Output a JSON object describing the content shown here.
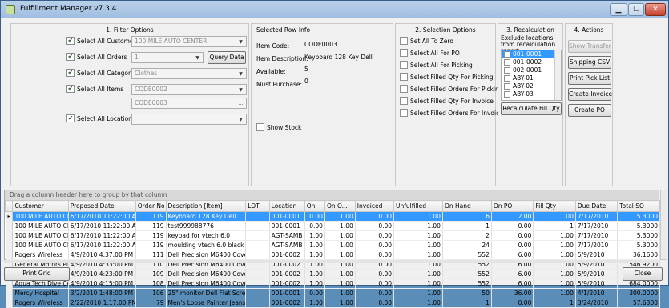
{
  "window": {
    "title": "Fulfillment Manager v7.3.4"
  },
  "filter": {
    "title": "1. Filter Options",
    "customers": {
      "label": "Select All Customers",
      "value": "100 MILE AUTO CENTER"
    },
    "orders": {
      "label": "Select All Orders",
      "value": "1",
      "button": "Query Data"
    },
    "categories": {
      "label": "Select All Categories",
      "value": "Clothes"
    },
    "items": {
      "label": "Select All Items",
      "value1": "CODE0002",
      "value2": "CODE0003"
    },
    "locations": {
      "label": "Select All Locations",
      "value": ""
    }
  },
  "row_info": {
    "title": "Selected Row Info",
    "item_code_label": "Item Code:",
    "item_code": "CODE0003",
    "desc_label": "Item Description:",
    "desc": "Keyboard 128 Key Dell",
    "available_label": "Available:",
    "available": "5",
    "must_purchase_label": "Must Purchase:",
    "must_purchase": "0",
    "show_stock": "Show Stock"
  },
  "selection": {
    "title": "2. Selection Options",
    "options": [
      "Set All To Zero",
      "Select All For PO",
      "Select All For Picking",
      "Select Filled Qty For Picking",
      "Select Filled Orders For Picking",
      "Select Filled Qty For Invoice",
      "Select Filled Orders For Invoice"
    ]
  },
  "recalc": {
    "title": "3. Recalculation",
    "note": "Exclude locations from recalculation report",
    "locations": [
      "001-0001",
      "001-0002",
      "002-0001",
      "ABY-01",
      "ABY-02",
      "ABY-03"
    ],
    "button": "Recalculate Fill Qty"
  },
  "actions": {
    "title": "4. Actions",
    "buttons": [
      "Show Transfer",
      "Shipping CSV",
      "Print Pick List",
      "Create Invoice",
      "Create PO"
    ]
  },
  "grid": {
    "group_hint": "Drag a column header here to group by that column",
    "columns": [
      "Customer",
      "Proposed Date",
      "Order No",
      "Description [Item]",
      "LOT",
      "Location",
      "On",
      "On O...",
      "Invoiced",
      "Unfulfilled",
      "On Hand",
      "On PO",
      "Fill Qty",
      "Due Date",
      "Total SO"
    ],
    "rows": [
      [
        "100 MILE AUTO CENTER",
        "6/17/2010 11:22:00 AM",
        "119",
        "Keyboard 128 Key Dell",
        "",
        "001-0001",
        "0.00",
        "1.00",
        "0.00",
        "1.00",
        "6",
        "2.00",
        "1.00",
        "7/17/2010",
        "5.3000"
      ],
      [
        "100 MILE AUTO CENTER",
        "6/17/2010 11:22:00 AM",
        "119",
        "test999988776",
        "",
        "001-0001",
        "0.00",
        "1.00",
        "0.00",
        "1.00",
        "1",
        "0.00",
        "1",
        "7/17/2010",
        "5.3000"
      ],
      [
        "100 MILE AUTO CENTER",
        "6/17/2010 11:22:00 AM",
        "119",
        "keypad for vtech 6.0",
        "",
        "AGT-SAMB",
        "1.00",
        "1.00",
        "0.00",
        "1.00",
        "2",
        "0.00",
        "1.00",
        "7/17/2010",
        "5.3000"
      ],
      [
        "100 MILE AUTO CENTER",
        "6/17/2010 11:22:00 AM",
        "119",
        "moulding vtech 6.0 black",
        "",
        "AGT-SAMB",
        "1.00",
        "1.00",
        "0.00",
        "1.00",
        "24",
        "0.00",
        "1.00",
        "7/17/2010",
        "5.3000"
      ],
      [
        "Rogers Wireless",
        "4/9/2010 4:37:00 PM",
        "111",
        "Dell Precision M6400 Covet",
        "",
        "001-0002",
        "1.00",
        "1.00",
        "0.00",
        "1.00",
        "552",
        "6.00",
        "1.00",
        "5/9/2010",
        "36.1600"
      ],
      [
        "General Motors Place",
        "4/9/2010 4:33:00 PM",
        "110",
        "Dell Precision M6400 Covet",
        "",
        "001-0002",
        "1.00",
        "1.00",
        "0.00",
        "1.00",
        "552",
        "6.00",
        "1.00",
        "5/9/2010",
        "546.9200"
      ],
      [
        "Aqua Tech Dive Center",
        "4/9/2010 4:23:00 PM",
        "109",
        "Dell Precision M6400 Covet",
        "",
        "001-0002",
        "1.00",
        "1.00",
        "0.00",
        "1.00",
        "552",
        "6.00",
        "1.00",
        "5/9/2010",
        "1384.0000"
      ],
      [
        "Aqua Tech Dive Center",
        "4/9/2010 4:15:00 PM",
        "108",
        "Dell Precision M6400 Covet",
        "",
        "001-0002",
        "1.00",
        "1.00",
        "0.00",
        "1.00",
        "552",
        "6.00",
        "1.00",
        "5/9/2010",
        "684.0000"
      ],
      [
        "Mercy Hospital",
        "3/2/2010 1:48:00 PM",
        "106",
        "25\" monitor Dell Flat Screen",
        "",
        "001-0001",
        "0.00",
        "1.00",
        "0.00",
        "1.00",
        "50",
        "36.00",
        "1.00",
        "4/1/2010",
        "300.0000"
      ],
      [
        "Rogers Wireless",
        "2/22/2010 1:17:00 PM",
        "79",
        "Men's Loose Painter Jeans",
        "",
        "001-0002",
        "1.00",
        "1.00",
        "0.00",
        "1.00",
        "1",
        "0.00",
        "1",
        "3/24/2010",
        "57.6300"
      ]
    ]
  },
  "footer": {
    "print": "Print Grid",
    "close": "Close"
  }
}
